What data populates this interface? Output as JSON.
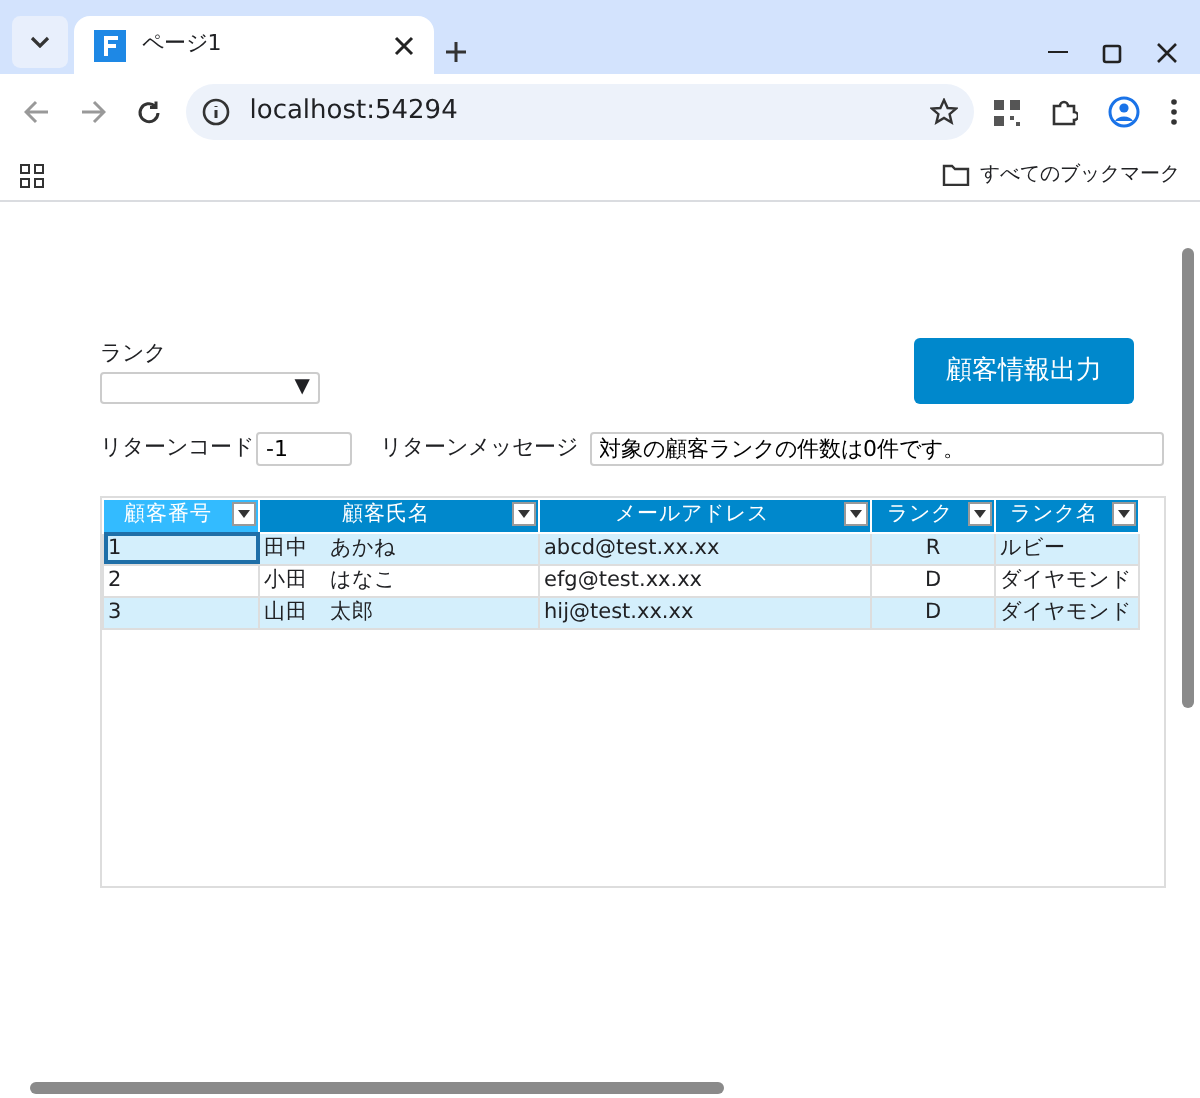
{
  "browser": {
    "tab_title": "ページ1",
    "address": "localhost:54294",
    "bookmarks_label": "すべてのブックマーク"
  },
  "form": {
    "rank_label": "ランク",
    "arrow": "▼",
    "output_button": "顧客情報出力",
    "return_code_label": "リターンコード",
    "return_code": "-1",
    "return_message_label": "リターンメッセージ",
    "return_message": "対象の顧客ランクの件数は0件です。"
  },
  "table": {
    "columns": [
      {
        "label": "顧客番号",
        "selected": true,
        "kind": "text"
      },
      {
        "label": "顧客氏名",
        "selected": false,
        "kind": "text"
      },
      {
        "label": "メールアドレス",
        "selected": false,
        "kind": "text"
      },
      {
        "label": "ランク",
        "selected": false,
        "kind": "code"
      },
      {
        "label": "ランク名",
        "selected": false,
        "kind": "text"
      }
    ],
    "rows": [
      {
        "cells": [
          "1",
          "田中　あかね",
          "abcd@test.xx.xx",
          "R",
          "ルビー"
        ],
        "current": true
      },
      {
        "cells": [
          "2",
          "小田　はなこ",
          "efg@test.xx.xx",
          "D",
          "ダイヤモンド"
        ],
        "current": false
      },
      {
        "cells": [
          "3",
          "山田　太郎",
          "hij@test.xx.xx",
          "D",
          "ダイヤモンド"
        ],
        "current": false
      }
    ]
  }
}
